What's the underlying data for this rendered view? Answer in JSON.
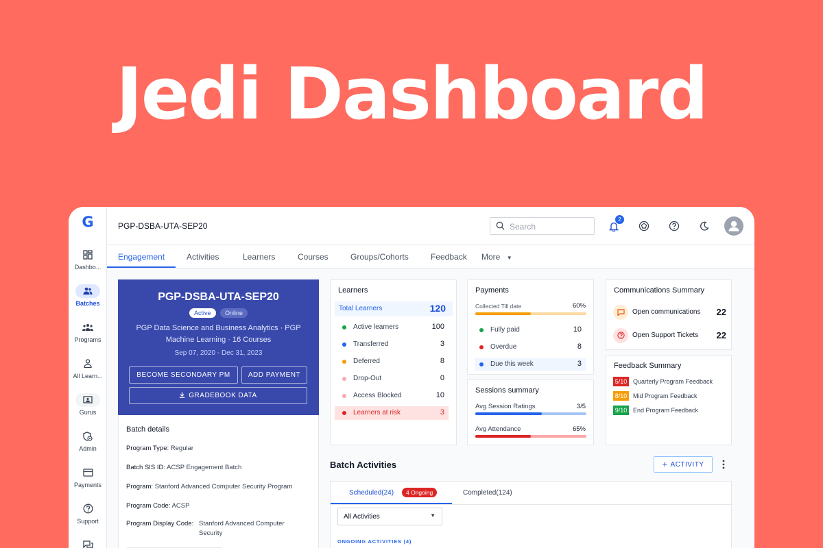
{
  "hero": {
    "title": "Jedi Dashboard"
  },
  "colors": {
    "background": "#FF6B5E",
    "primary": "#2563eb",
    "batch_card": "#3949ab",
    "risk": "#dc2626",
    "success": "#16a34a",
    "warning": "#f59e0b"
  },
  "logo": "G",
  "sidebar": {
    "items": [
      {
        "label": "Dashbo...",
        "icon": "dashboard-icon",
        "active": false
      },
      {
        "label": "Batches",
        "icon": "batches-icon",
        "active": true
      },
      {
        "label": "Programs",
        "icon": "programs-icon",
        "active": false
      },
      {
        "label": "All Learn...",
        "icon": "learner-icon",
        "active": false
      },
      {
        "label": "Gurus",
        "icon": "gurus-icon",
        "active": false
      },
      {
        "label": "Admin",
        "icon": "admin-icon",
        "active": false
      },
      {
        "label": "Payments",
        "icon": "payments-icon",
        "active": false
      },
      {
        "label": "Support",
        "icon": "support-icon",
        "active": false
      }
    ]
  },
  "topbar": {
    "batch_code": "PGP-DSBA-UTA-SEP20",
    "search_placeholder": "Search",
    "notification_count": "2"
  },
  "tabs": {
    "items": [
      "Engagement",
      "Activities",
      "Learners",
      "Courses",
      "Groups/Cohorts",
      "Feedback",
      "More"
    ],
    "active": "Engagement"
  },
  "batch_card": {
    "title": "PGP-DSBA-UTA-SEP20",
    "status": "Active",
    "mode": "Online",
    "description": "PGP Data Science and Business Analytics · PGP Machine Learning  · 16 Courses",
    "dates": "Sep 07, 2020 - Dec 31, 2023",
    "btn_secondary_pm": "BECOME SECONDARY PM",
    "btn_add_payment": "ADD PAYMENT",
    "btn_gradebook": "GRADEBOOK DATA"
  },
  "batch_details": {
    "title": "Batch details",
    "rows": [
      {
        "label": "Program Type:",
        "value": "Regular"
      },
      {
        "label": "Batch SIS ID:",
        "value": "ACSP Engagement Batch"
      },
      {
        "label": "Program:",
        "value": "Stanford Advanced Computer Security Program"
      },
      {
        "label": "Program Code:",
        "value": "ACSP"
      },
      {
        "label": "Program Display Code:",
        "value": "Stanford Advanced Computer Security"
      }
    ]
  },
  "learners": {
    "title": "Learners",
    "total_label": "Total Learners",
    "total": "120",
    "rows": [
      {
        "label": "Active learners",
        "value": "100",
        "color": "#16a34a"
      },
      {
        "label": "Transferred",
        "value": "3",
        "color": "#2563eb"
      },
      {
        "label": "Deferred",
        "value": "8",
        "color": "#f59e0b"
      },
      {
        "label": "Drop-Out",
        "value": "0",
        "color": "#f9a8b4"
      },
      {
        "label": "Access Blocked",
        "value": "10",
        "color": "#f9a8b4"
      },
      {
        "label": "Learners at risk",
        "value": "3",
        "color": "#dc2626"
      }
    ]
  },
  "payments": {
    "title": "Payments",
    "collected_label": "Collected Till date",
    "collected_pct": "60%",
    "collected_fraction": 0.5,
    "rows": [
      {
        "label": "Fully paid",
        "value": "10",
        "color": "#16a34a"
      },
      {
        "label": "Overdue",
        "value": "8",
        "color": "#dc2626"
      },
      {
        "label": "Due this week",
        "value": "3",
        "color": "#2563eb"
      }
    ]
  },
  "sessions": {
    "title": "Sessions summary",
    "rating_label": "Avg Session Ratings",
    "rating_value": "3/5",
    "rating_fraction": 0.6,
    "attendance_label": "Avg Attendance",
    "attendance_value": "65%",
    "attendance_fraction": 0.5
  },
  "communications": {
    "title": "Communications Summary",
    "open_label": "Open communications",
    "open_value": "22",
    "tickets_label": "Open Support Tickets",
    "tickets_value": "22"
  },
  "feedback": {
    "title": "Feedback Summary",
    "rows": [
      {
        "score": "5/10",
        "label": "Quarterly Program Feedback",
        "color": "#dc2626"
      },
      {
        "score": "8/10",
        "label": "Mid Program Feedback",
        "color": "#f59e0b"
      },
      {
        "score": "9/10",
        "label": "End Program Feedback",
        "color": "#16a34a"
      }
    ]
  },
  "batch_activities": {
    "title": "Batch Activities",
    "add_label": "ACTIVITY",
    "tab_scheduled": "Scheduled(24)",
    "ongoing_badge": "4 Ongoing",
    "tab_completed": "Completed(124)",
    "filter_value": "All Activities",
    "ongoing_header": "ONGOING ACTIVITIES (4)"
  }
}
